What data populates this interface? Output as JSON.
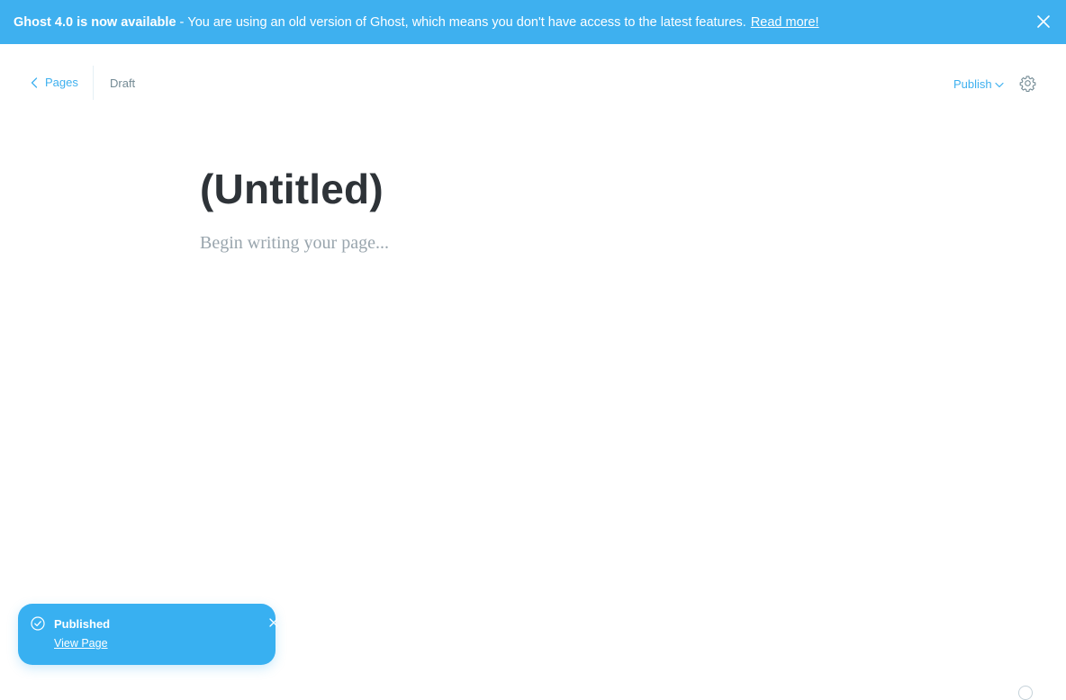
{
  "banner": {
    "headline": "Ghost 4.0 is now available",
    "separator": "-",
    "message": "You are using an old version of Ghost, which means you don't have access to the latest features.",
    "link_label": "Read more!",
    "close_icon": "close-icon",
    "background": "#3eb0ef"
  },
  "header": {
    "back_label": "Pages",
    "back_icon": "chevron-left-icon",
    "status": "Draft",
    "publish_label": "Publish",
    "publish_icon": "chevron-down-icon",
    "settings_icon": "gear-icon"
  },
  "editor": {
    "title": "(Untitled)",
    "body_placeholder": "Begin writing your page..."
  },
  "toast": {
    "title": "Published",
    "link_label": "View Page",
    "status_icon": "check-circle-icon",
    "close_icon": "close-icon",
    "background": "#38b0f1"
  }
}
